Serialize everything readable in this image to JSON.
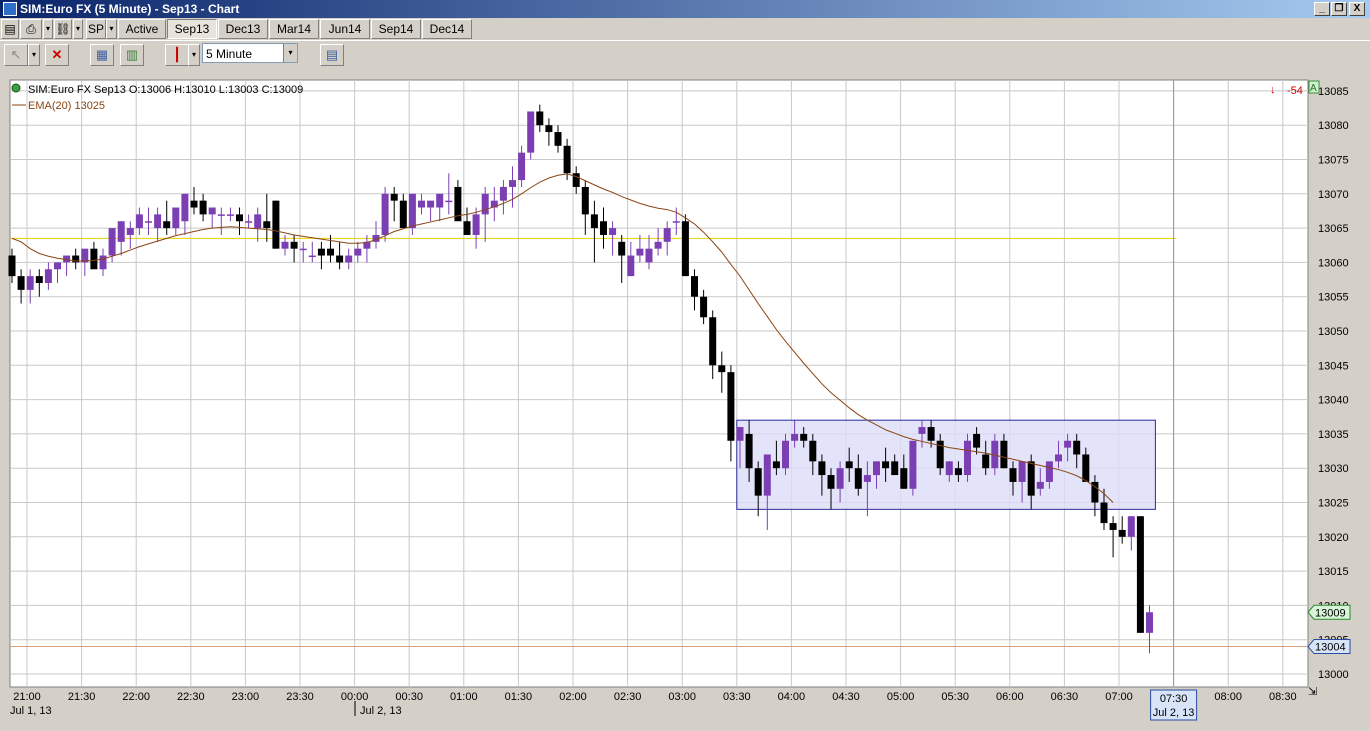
{
  "window": {
    "title": "SIM:Euro FX (5 Minute) - Sep13 - Chart",
    "buttons": [
      "_",
      "❐",
      "X"
    ]
  },
  "toolbar1": {
    "instrument": "SP",
    "tabs": [
      "Active",
      "Sep13",
      "Dec13",
      "Mar14",
      "Jun14",
      "Sep14",
      "Dec14"
    ],
    "selected_tab": "Sep13"
  },
  "toolbar2": {
    "interval": "5 Minute"
  },
  "chart_header": {
    "instrument_line": "SIM:Euro FX Sep13 O:13006 H:13010 L:13003 C:13009",
    "ema_line": "EMA(20)  13025",
    "pnl": "-54",
    "pnl_color": "#cc0000",
    "flag": "A"
  },
  "chart_data": {
    "type": "candlestick",
    "price_axis": {
      "min": 13000,
      "max": 13085,
      "ticks": [
        13085,
        13080,
        13075,
        13070,
        13065,
        13060,
        13055,
        13050,
        13045,
        13040,
        13035,
        13030,
        13025,
        13020,
        13015,
        13010,
        13005,
        13000
      ]
    },
    "time_axis": {
      "ticks": [
        "21:00",
        "21:30",
        "22:00",
        "22:30",
        "23:00",
        "23:30",
        "00:00",
        "00:30",
        "01:00",
        "01:30",
        "02:00",
        "02:30",
        "03:00",
        "03:30",
        "04:00",
        "04:30",
        "05:00",
        "05:30",
        "06:00",
        "06:30",
        "07:00",
        "07:30",
        "08:00",
        "08:30"
      ],
      "date_labels": [
        "Jul 1, 13",
        "Jul 2, 13"
      ],
      "cursor_label": [
        "07:30",
        "Jul 2, 13"
      ]
    },
    "last_price_label": "13009",
    "ask_price_label": "13004",
    "horizontal_line_price": 13063.5,
    "range_box": {
      "price_high": 13037,
      "price_low": 13024,
      "time_start": "03:30",
      "time_end": "07:20"
    },
    "colors": {
      "up": "#7b3fb3",
      "down": "#000000",
      "ema": "#8b4513",
      "hline": "#e8d000",
      "box_fill": "#dcdcf8",
      "box_stroke": "#2a2aa0"
    },
    "candles_ohlc": [
      [
        13061,
        13062,
        13057,
        13058
      ],
      [
        13058,
        13059,
        13054,
        13056
      ],
      [
        13056,
        13059,
        13054,
        13058
      ],
      [
        13058,
        13059,
        13055,
        13057
      ],
      [
        13057,
        13060,
        13056,
        13059
      ],
      [
        13059,
        13060,
        13057,
        13060
      ],
      [
        13060,
        13061,
        13058,
        13061
      ],
      [
        13061,
        13062,
        13059,
        13060
      ],
      [
        13060,
        13061,
        13058,
        13062
      ],
      [
        13062,
        13063,
        13060,
        13059
      ],
      [
        13059,
        13062,
        13058,
        13061
      ],
      [
        13061,
        13065,
        13060,
        13065
      ],
      [
        13063,
        13066,
        13061,
        13066
      ],
      [
        13064,
        13066,
        13062,
        13065
      ],
      [
        13065,
        13068,
        13064,
        13067
      ],
      [
        13066,
        13068,
        13064,
        13066
      ],
      [
        13065,
        13068,
        13063,
        13067
      ],
      [
        13066,
        13069,
        13064,
        13065
      ],
      [
        13065,
        13068,
        13064,
        13068
      ],
      [
        13066,
        13070,
        13064,
        13070
      ],
      [
        13069,
        13071,
        13067,
        13068
      ],
      [
        13069,
        13070,
        13066,
        13067
      ],
      [
        13067,
        13068,
        13065,
        13068
      ],
      [
        13067,
        13068,
        13064,
        13067
      ],
      [
        13067,
        13068,
        13066,
        13067
      ],
      [
        13067,
        13068,
        13064,
        13066
      ],
      [
        13066,
        13067,
        13065,
        13066
      ],
      [
        13065,
        13068,
        13063,
        13067
      ],
      [
        13066,
        13070,
        13063,
        13065
      ],
      [
        13069,
        13069,
        13062,
        13062
      ],
      [
        13062,
        13064,
        13061,
        13063
      ],
      [
        13063,
        13064,
        13060,
        13062
      ],
      [
        13062,
        13063,
        13060,
        13062
      ],
      [
        13061,
        13063,
        13060,
        13061
      ],
      [
        13062,
        13063,
        13059,
        13061
      ],
      [
        13062,
        13064,
        13060,
        13061
      ],
      [
        13061,
        13063,
        13059,
        13060
      ],
      [
        13060,
        13062,
        13059,
        13061
      ],
      [
        13061,
        13063,
        13060,
        13062
      ],
      [
        13062,
        13064,
        13060,
        13063
      ],
      [
        13063,
        13066,
        13062,
        13064
      ],
      [
        13064,
        13071,
        13063,
        13070
      ],
      [
        13070,
        13071,
        13066,
        13069
      ],
      [
        13069,
        13070,
        13066,
        13065
      ],
      [
        13065,
        13070,
        13064,
        13070
      ],
      [
        13068,
        13070,
        13067,
        13069
      ],
      [
        13068,
        13069,
        13066,
        13069
      ],
      [
        13068,
        13070,
        13066,
        13070
      ],
      [
        13069,
        13073,
        13067,
        13069
      ],
      [
        13071,
        13072,
        13067,
        13066
      ],
      [
        13066,
        13068,
        13064,
        13064
      ],
      [
        13064,
        13068,
        13062,
        13067
      ],
      [
        13067,
        13071,
        13063,
        13070
      ],
      [
        13068,
        13071,
        13066,
        13069
      ],
      [
        13069,
        13072,
        13067,
        13071
      ],
      [
        13071,
        13074,
        13068,
        13072
      ],
      [
        13072,
        13077,
        13071,
        13076
      ],
      [
        13076,
        13082,
        13075,
        13082
      ],
      [
        13082,
        13083,
        13079,
        13080
      ],
      [
        13080,
        13081,
        13077,
        13079
      ],
      [
        13079,
        13080,
        13076,
        13077
      ],
      [
        13077,
        13078,
        13072,
        13073
      ],
      [
        13073,
        13074,
        13070,
        13071
      ],
      [
        13071,
        13072,
        13064,
        13067
      ],
      [
        13067,
        13069,
        13060,
        13065
      ],
      [
        13066,
        13068,
        13062,
        13064
      ],
      [
        13064,
        13066,
        13061,
        13065
      ],
      [
        13063,
        13064,
        13057,
        13061
      ],
      [
        13058,
        13063,
        13058,
        13061
      ],
      [
        13061,
        13064,
        13060,
        13062
      ],
      [
        13060,
        13064,
        13059,
        13062
      ],
      [
        13062,
        13065,
        13061,
        13063
      ],
      [
        13063,
        13066,
        13061,
        13065
      ],
      [
        13066,
        13068,
        13064,
        13066
      ],
      [
        13066,
        13067,
        13058,
        13058
      ],
      [
        13058,
        13059,
        13053,
        13055
      ],
      [
        13055,
        13056,
        13051,
        13052
      ],
      [
        13052,
        13053,
        13043,
        13045
      ],
      [
        13045,
        13047,
        13041,
        13044
      ],
      [
        13044,
        13045,
        13031,
        13034
      ],
      [
        13034,
        13036,
        13030,
        13036
      ],
      [
        13035,
        13037,
        13028,
        13030
      ],
      [
        13030,
        13031,
        13023,
        13026
      ],
      [
        13026,
        13032,
        13021,
        13032
      ],
      [
        13031,
        13034,
        13029,
        13030
      ],
      [
        13030,
        13035,
        13029,
        13034
      ],
      [
        13034,
        13037,
        13033,
        13035
      ],
      [
        13035,
        13036,
        13033,
        13034
      ],
      [
        13034,
        13035,
        13029,
        13031
      ],
      [
        13031,
        13032,
        13026,
        13029
      ],
      [
        13029,
        13030,
        13024,
        13027
      ],
      [
        13027,
        13031,
        13025,
        13030
      ],
      [
        13031,
        13033,
        13028,
        13030
      ],
      [
        13030,
        13032,
        13026,
        13027
      ],
      [
        13028,
        13031,
        13023,
        13029
      ],
      [
        13029,
        13031,
        13027,
        13031
      ],
      [
        13031,
        13033,
        13028,
        13030
      ],
      [
        13031,
        13032,
        13029,
        13029
      ],
      [
        13030,
        13032,
        13027,
        13027
      ],
      [
        13027,
        13034,
        13026,
        13034
      ],
      [
        13035,
        13037,
        13033,
        13036
      ],
      [
        13036,
        13037,
        13033,
        13034
      ],
      [
        13034,
        13035,
        13029,
        13030
      ],
      [
        13029,
        13031,
        13028,
        13031
      ],
      [
        13030,
        13031,
        13028,
        13029
      ],
      [
        13029,
        13035,
        13028,
        13034
      ],
      [
        13035,
        13036,
        13032,
        13033
      ],
      [
        13032,
        13034,
        13029,
        13030
      ],
      [
        13030,
        13035,
        13029,
        13034
      ],
      [
        13034,
        13035,
        13030,
        13030
      ],
      [
        13030,
        13031,
        13026,
        13028
      ],
      [
        13028,
        13031,
        13025,
        13031
      ],
      [
        13031,
        13032,
        13024,
        13026
      ],
      [
        13027,
        13030,
        13026,
        13028
      ],
      [
        13028,
        13031,
        13027,
        13031
      ],
      [
        13031,
        13034,
        13030,
        13032
      ],
      [
        13033,
        13035,
        13031,
        13034
      ],
      [
        13034,
        13035,
        13030,
        13032
      ],
      [
        13032,
        13033,
        13028,
        13028
      ],
      [
        13028,
        13029,
        13023,
        13025
      ],
      [
        13025,
        13027,
        13021,
        13022
      ],
      [
        13022,
        13023,
        13017,
        13021
      ],
      [
        13021,
        13023,
        13019,
        13020
      ],
      [
        13020,
        13023,
        13018,
        13023
      ],
      [
        13023,
        13023,
        13006,
        13006
      ],
      [
        13006,
        13010,
        13003,
        13009
      ]
    ],
    "ema_values": [
      13063.5,
      13063.0,
      13062.0,
      13061.3,
      13060.9,
      13060.6,
      13060.4,
      13060.2,
      13060.2,
      13060.3,
      13060.5,
      13060.9,
      13061.3,
      13061.8,
      13062.3,
      13062.7,
      13063.1,
      13063.5,
      13063.9,
      13064.2,
      13064.5,
      13064.8,
      13065.0,
      13065.1,
      13065.2,
      13065.1,
      13065.0,
      13064.9,
      13064.8,
      13064.6,
      13064.3,
      13064.0,
      13063.8,
      13063.6,
      13063.4,
      13063.2,
      13063.0,
      13062.8,
      13062.8,
      13062.9,
      13063.3,
      13063.9,
      13064.5,
      13064.9,
      13065.3,
      13065.6,
      13065.9,
      13066.2,
      13066.5,
      13066.8,
      13067.0,
      13067.3,
      13067.7,
      13068.1,
      13068.6,
      13069.2,
      13070.0,
      13070.9,
      13071.7,
      13072.3,
      13072.7,
      13072.9,
      13072.5,
      13071.9,
      13071.3,
      13070.7,
      13070.2,
      13069.6,
      13069.1,
      13068.6,
      13068.2,
      13067.9,
      13067.7,
      13067.3,
      13066.5,
      13065.6,
      13064.4,
      13063.0,
      13061.5,
      13059.7,
      13058.0,
      13056.0,
      13054.0,
      13052.1,
      13050.2,
      13048.5,
      13046.9,
      13045.3,
      13043.8,
      13042.3,
      13041.0,
      13039.9,
      13038.8,
      13037.8,
      13037.0,
      13036.3,
      13035.6,
      13035.1,
      13034.6,
      13034.2,
      13033.9,
      13033.6,
      13033.3,
      13033.0,
      13032.8,
      13032.6,
      13032.4,
      13032.2,
      13031.9,
      13031.6,
      13031.3,
      13031.0,
      13030.7,
      13030.4,
      13030.1,
      13029.8,
      13029.4,
      13028.9,
      13028.2,
      13027.3,
      13026.3,
      13025.0
    ]
  }
}
